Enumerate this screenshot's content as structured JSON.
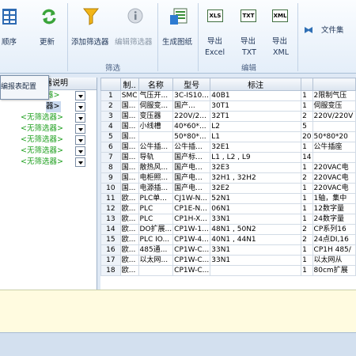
{
  "ribbon": {
    "order_label": "顺序",
    "refresh_label": "更新",
    "add_filter_label": "添加筛选器",
    "edit_filter_label": "编辑筛选器",
    "filter_group": "筛选",
    "gen_drawing_label": "生成图纸",
    "export_excel_label": "导出\nExcel",
    "export_excel_line1": "导出",
    "export_excel_line2": "Excel",
    "export_txt_line1": "导出",
    "export_txt_line2": "TXT",
    "export_xml_line1": "导出",
    "export_xml_line2": "XML",
    "edit_group": "编辑",
    "file_set_label": "文件集",
    "xls_icon": "XLS",
    "txt_icon": "TXT",
    "xml_icon": "XML"
  },
  "left_panel": {
    "header": "器说明",
    "popup_label": "编报表配置",
    "rows": [
      {
        "text": "器>",
        "selected": false
      },
      {
        "text": "器>",
        "selected": true
      },
      {
        "text": "<无筛选器>",
        "selected": false
      },
      {
        "text": "<无筛选器>",
        "selected": false
      },
      {
        "text": "<无筛选器>",
        "selected": false
      },
      {
        "text": "<无筛选器>",
        "selected": false
      },
      {
        "text": "<无筛选器>",
        "selected": false
      }
    ]
  },
  "grid": {
    "headers": [
      "",
      "制..",
      "名称",
      "型号",
      "标注",
      "",
      ""
    ],
    "rows": [
      [
        "1",
        "SMC",
        "气压开...",
        "3C-IS10...",
        "40B1",
        "1",
        "2限制气压"
      ],
      [
        "2",
        "国...",
        "伺服变...",
        "国产...",
        "30T1",
        "1",
        "伺服变压"
      ],
      [
        "3",
        "国...",
        "变压器",
        "220V/2...",
        "32T1",
        "2",
        "220V/220V"
      ],
      [
        "4",
        "国...",
        "小线槽",
        "40*60*...",
        "L2",
        "5",
        ""
      ],
      [
        "5",
        "国...",
        "",
        "50*80*...",
        "L1",
        "20",
        "50*80*20"
      ],
      [
        "6",
        "国...",
        "公牛插...",
        "公牛插...",
        "32E1",
        "1",
        "公牛插座"
      ],
      [
        "7",
        "国...",
        "导轨",
        "国产标...",
        "L1 , L2 , L9",
        "14",
        ""
      ],
      [
        "8",
        "国...",
        "散热风...",
        "国产电...",
        "32E3",
        "1",
        "220VAC电"
      ],
      [
        "9",
        "国...",
        "电柜照...",
        "国产电...",
        "32H1 , 32H2",
        "2",
        "220VAC电"
      ],
      [
        "10",
        "国...",
        "电源插...",
        "国产电...",
        "32E2",
        "1",
        "220VAC电"
      ],
      [
        "11",
        "欧...",
        "PLC单...",
        "CJ1W-N...",
        "52N1",
        "1",
        "1轴，集中"
      ],
      [
        "12",
        "欧...",
        "PLC",
        "CP1E-N...",
        "06N1",
        "1",
        "12数字量"
      ],
      [
        "13",
        "欧...",
        "PLC",
        "CP1H-X...",
        "33N1",
        "1",
        "24数字量"
      ],
      [
        "14",
        "欧...",
        "DO扩展...",
        "CP1W-1...",
        "48N1 , 50N2",
        "2",
        "CP系列16"
      ],
      [
        "15",
        "欧...",
        "PLC IO...",
        "CP1W-4...",
        "40N1 , 44N1",
        "2",
        "24点DI,16"
      ],
      [
        "16",
        "欧...",
        "485通...",
        "CP1W-C...",
        "33N1",
        "1",
        "CP1H 485/"
      ],
      [
        "17",
        "欧...",
        "以太网...",
        "CP1W-C...",
        "33N1",
        "1",
        "以太网从"
      ],
      [
        "18",
        "欧...",
        "",
        "CP1W-C...",
        "",
        "1",
        "80cm扩展"
      ]
    ]
  }
}
